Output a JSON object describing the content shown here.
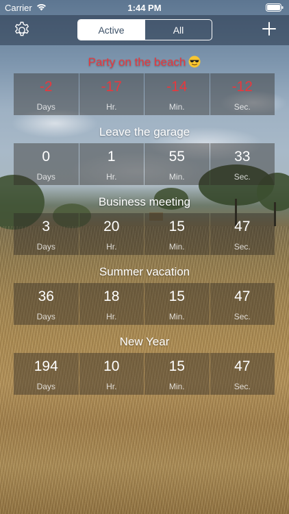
{
  "status_bar": {
    "carrier": "Carrier",
    "time": "1:44 PM"
  },
  "nav": {
    "settings_icon": "gear-icon",
    "add_icon": "plus-icon",
    "segments": [
      {
        "label": "Active",
        "selected": true
      },
      {
        "label": "All",
        "selected": false
      }
    ]
  },
  "colors": {
    "overdue": "#e8383d",
    "text": "#ffffff",
    "segment_selected_text": "#3b4f66"
  },
  "countdowns": [
    {
      "title": "Party on the beach",
      "emoji": "smiling-face-with-sunglasses",
      "overdue": true,
      "days": "-2",
      "hours": "-17",
      "minutes": "-14",
      "seconds": "-12",
      "units": {
        "days": "Days",
        "hours": "Hr.",
        "minutes": "Min.",
        "seconds": "Sec."
      }
    },
    {
      "title": "Leave the garage",
      "overdue": false,
      "days": "0",
      "hours": "1",
      "minutes": "55",
      "seconds": "33",
      "units": {
        "days": "Days",
        "hours": "Hr.",
        "minutes": "Min.",
        "seconds": "Sec."
      }
    },
    {
      "title": "Business meeting",
      "overdue": false,
      "days": "3",
      "hours": "20",
      "minutes": "15",
      "seconds": "47",
      "units": {
        "days": "Days",
        "hours": "Hr.",
        "minutes": "Min.",
        "seconds": "Sec."
      }
    },
    {
      "title": "Summer vacation",
      "overdue": false,
      "days": "36",
      "hours": "18",
      "minutes": "15",
      "seconds": "47",
      "units": {
        "days": "Days",
        "hours": "Hr.",
        "minutes": "Min.",
        "seconds": "Sec."
      }
    },
    {
      "title": "New Year",
      "overdue": false,
      "days": "194",
      "hours": "10",
      "minutes": "15",
      "seconds": "47",
      "units": {
        "days": "Days",
        "hours": "Hr.",
        "minutes": "Min.",
        "seconds": "Sec."
      }
    }
  ]
}
